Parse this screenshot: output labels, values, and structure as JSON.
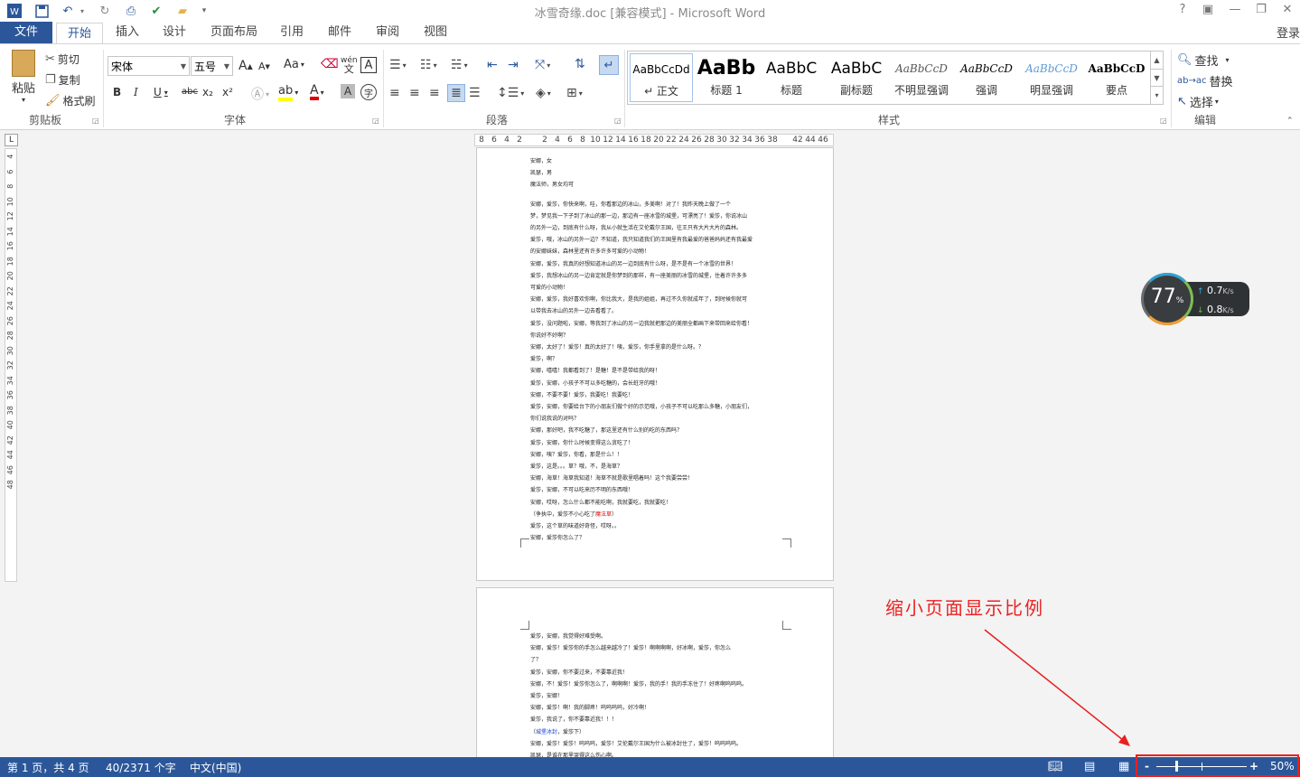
{
  "window": {
    "title": "冰雪奇缘.doc [兼容模式] - Microsoft Word",
    "help": "?",
    "signin": "登录"
  },
  "quick_access": [
    "word-logo-icon",
    "save-icon",
    "undo-icon",
    "redo-icon",
    "print-preview-icon",
    "spelling-icon",
    "open-folder-icon",
    "customize-icon"
  ],
  "tabs": [
    "文件",
    "开始",
    "插入",
    "设计",
    "页面布局",
    "引用",
    "邮件",
    "审阅",
    "视图"
  ],
  "active_tab": "开始",
  "ribbon": {
    "clipboard": {
      "label": "剪贴板",
      "paste": "粘贴",
      "cut": "剪切",
      "copy": "复制",
      "format_painter": "格式刷"
    },
    "font": {
      "label": "字体",
      "font_name": "宋体",
      "font_size": "五号",
      "grow": "A",
      "shrink": "A",
      "case": "Aa",
      "wen": "wén",
      "bold": "B",
      "italic": "I",
      "underline": "U",
      "strike": "abc",
      "sub": "x₂",
      "sup": "x²"
    },
    "paragraph": {
      "label": "段落"
    },
    "styles": {
      "label": "样式",
      "items": [
        {
          "preview": "AaBbCcDd",
          "name": "↵ 正文"
        },
        {
          "preview": "AaBb",
          "name": "标题 1"
        },
        {
          "preview": "AaBbC",
          "name": "标题"
        },
        {
          "preview": "AaBbC",
          "name": "副标题"
        },
        {
          "preview": "AaBbCcD",
          "name": "不明显强调"
        },
        {
          "preview": "AaBbCcD",
          "name": "强调"
        },
        {
          "preview": "AaBbCcD",
          "name": "明显强调"
        },
        {
          "preview": "AaBbCcD",
          "name": "要点"
        }
      ]
    },
    "editing": {
      "label": "编辑",
      "find": "查找",
      "replace": "替换",
      "select": "选择"
    }
  },
  "ruler": {
    "corner": "L",
    "horizontal": [
      "8",
      "6",
      "4",
      "2",
      "",
      "2",
      "4",
      "6",
      "8",
      "10",
      "12",
      "14",
      "16",
      "18",
      "20",
      "22",
      "24",
      "26",
      "28",
      "30",
      "32",
      "34",
      "36",
      "38",
      "",
      "42",
      "44",
      "46"
    ],
    "vertical": [
      "4",
      "6",
      "8",
      "10",
      "12",
      "14",
      "16",
      "18",
      "20",
      "22",
      "24",
      "26",
      "28",
      "30",
      "32",
      "34",
      "36",
      "38",
      "40",
      "42",
      "44",
      "46",
      "48"
    ]
  },
  "page1_lines": [
    "安娜，女",
    "凯瑟，男",
    "魔法师，男女均可",
    "",
    "安娜，爱莎，你快来啊，哇，你看那边的冰山，多美啊！对了！我昨天晚上做了一个",
    "梦，梦见我一下子到了冰山的那一边，那边有一座冰雪的城堡，可漂亮了！爱莎，你说冰山",
    "的另外一边，到底有什么呀，我从小就生活在艾伦戴尔王国，往王只有大片大片的森林。",
    "爱莎，哦，冰山的另外一边？不知道，我只知道我们的王国里有我最爱的爸爸妈妈还有我最爱",
    "的安娜妹妹，森林里还有许多许多可爱的小动物！",
    "安娜，爱莎，我真的好想知道冰山的另一边到底有什么呀，是不是有一个冰雪的世界！",
    "爱莎，我想冰山的另一边肯定就是你梦到的那样，有一座美丽的冰雪的城堡，住着许许多多",
    "可爱的小动物！",
    "安娜，爱莎，我好喜欢你啊，你比我大，是我的姐姐，再过不久你就成年了，到时候你就可",
    "以带我去冰山的另外一边去看看了。",
    "爱莎，没问题啦，安娜，等我到了冰山的另一边我就把那边的美丽全都画下来带回来给你看！",
    "你说好不好啊？",
    "安娜，太好了！爱莎！真的太好了！咦，爱莎，你手里拿的是什么呀。？",
    "爱莎，啊？",
    "安娜，嘻嘻！我都看到了！是糖！是不是带给我的呀！",
    "爱莎，安娜，小孩子不可以多吃糖的，会长蛀牙的哦！",
    "安娜，不要不要！爱莎，我要吃！我要吃！",
    "爱莎，安娜，你要给台下的小朋友们做个好的示范哦，小孩子不可以吃那么多糖，小朋友们，",
    "你们说我说的对吗？",
    "安娜，那好吧，我不吃糖了，那这里还有什么别的吃的东西吗？",
    "爱莎，安娜，你什么时候变得这么贪吃了！",
    "安娜，咦？爱莎，你看，那是什么！！",
    "爱莎，这是。。。草？哦，不，是海草？",
    "安娜，海草！海草我知道！海草不就是歌里唱着吗！这个我要尝尝！",
    "爱莎，安娜，不可以吃来历不明的东西哦！",
    "安娜，哎呀，怎么什么都不能吃啊，我就要吃，我就要吃！",
    "（争执中，爱莎不小心吃了魔法草）",
    "爱莎，这个草的味道好奇怪，哎呀。。",
    "安娜，爱莎你怎么了？"
  ],
  "page2_lines": [
    "爱莎，安娜，我觉得好难受啊。",
    "安娜，爱莎！爱莎你的手怎么越来越冷了！爱莎！啊啊啊啊，好冰啊，爱莎，你怎么",
    "了？",
    "爱莎，安娜，你不要过来，不要靠近我！",
    "安娜，不！爱莎！爱莎你怎么了，啊啊啊！爱莎，我的手！我的手冻住了！好疼啊呜呜呜。",
    "爱莎，安娜！",
    "安娜，爱莎！啊！我的脚疼！呜呜呜呜，好冷啊！",
    "爱莎，我说了，你不要靠近我！！！",
    "（城堡冰封，爱莎下）",
    "安娜，爱莎！爱莎！呜呜呜，爱莎！艾伦戴尔王国为什么被冰封住了，爱莎！呜呜呜呜。",
    "凯瑟，是谁在那里哭得这么伤心啊。"
  ],
  "red_phrases": [
    "魔法草"
  ],
  "blue_phrases": [
    "城堡冰封"
  ],
  "speed_widget": {
    "percent": "77",
    "unit": "%",
    "up": "0.7",
    "down": "0.8",
    "rate_unit": "K/s"
  },
  "annotation": "缩小页面显示比例",
  "status": {
    "page": "第 1 页，共 4 页",
    "words": "40/2371 个字",
    "language": "中文(中国)",
    "zoom": "50%",
    "zoom_minus": "-",
    "zoom_plus": "+"
  }
}
